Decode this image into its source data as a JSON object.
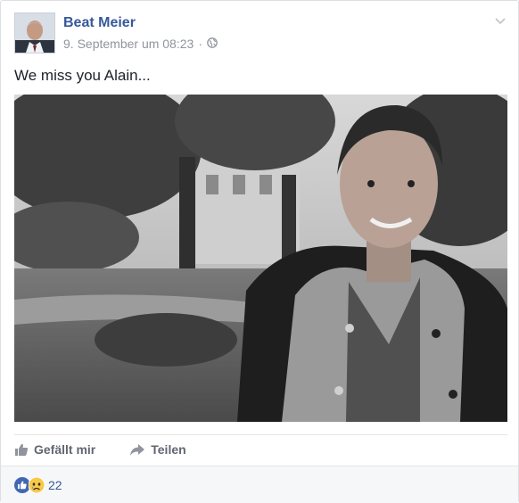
{
  "post": {
    "author": "Beat Meier",
    "timestamp": "9. September um 08:23",
    "separator": "·",
    "privacy_icon": "globe-icon",
    "text": "We miss you Alain..."
  },
  "actions": {
    "like_label": "Gefällt mir",
    "share_label": "Teilen"
  },
  "reactions": {
    "types": [
      "like",
      "sad"
    ],
    "count": "22"
  },
  "colors": {
    "link": "#365899",
    "secondary": "#90949c",
    "action_text": "#606770",
    "footer_bg": "#f6f7f9",
    "like_blue": "#4267b2",
    "sad_yellow": "#f7c94a"
  }
}
